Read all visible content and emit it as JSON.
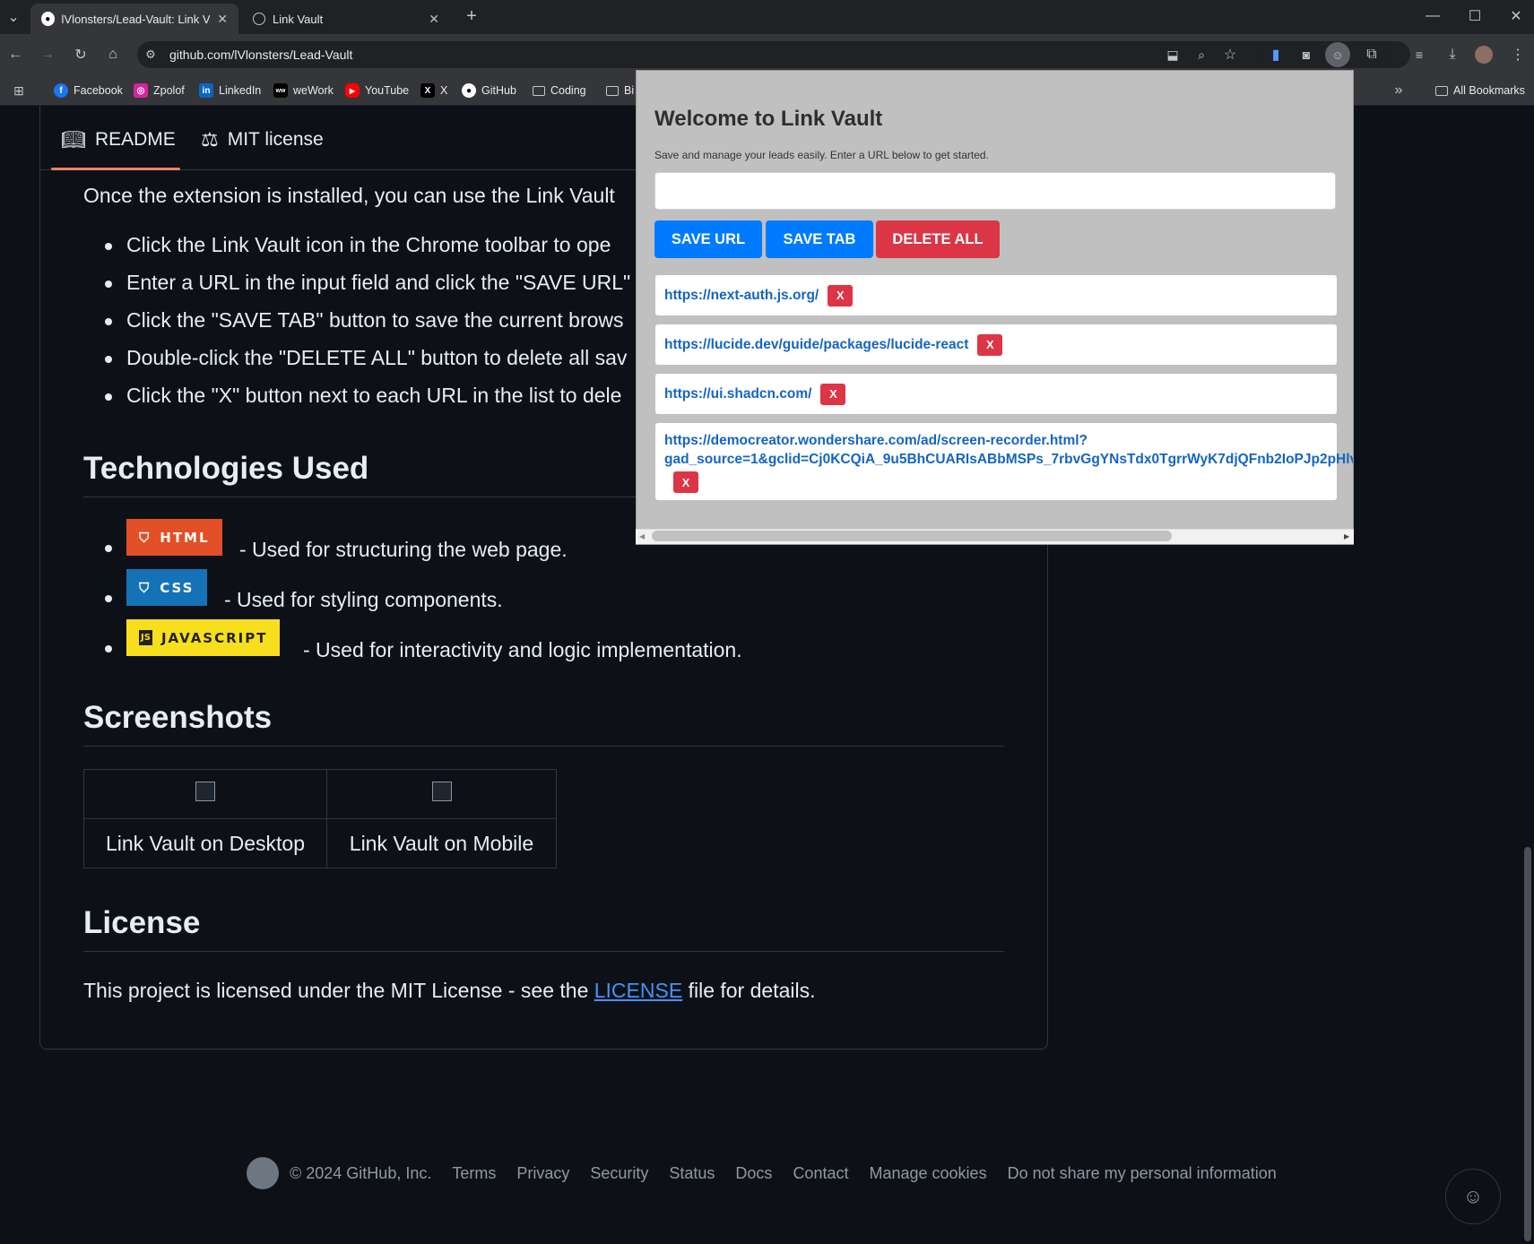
{
  "browser": {
    "tabs": [
      {
        "title": "lVlonsters/Lead-Vault: Link Vaul"
      },
      {
        "title": "Link Vault"
      }
    ],
    "url": "github.com/lVlonsters/Lead-Vault",
    "bookmarks": [
      "Facebook",
      "Zpolof",
      "LinkedIn",
      "weWork",
      "YouTube",
      "X",
      "GitHub",
      "Coding",
      "Bi"
    ],
    "all_bookmarks": "All Bookmarks"
  },
  "readme": {
    "tabs": [
      "README",
      "MIT license"
    ],
    "intro": "Once the extension is installed, you can use the Link Vault",
    "usage": [
      "Click the Link Vault icon in the Chrome toolbar to ope",
      "Enter a URL in the input field and click the \"SAVE URL\"",
      "Click the \"SAVE TAB\" button to save the current brows",
      "Double-click the \"DELETE ALL\" button to delete all sav",
      "Click the \"X\" button next to each URL in the list to dele"
    ],
    "tech_heading": "Technologies Used",
    "tech": [
      {
        "badge": "HTML",
        "text": "- Used for structuring the web page.",
        "color": "#e34f26"
      },
      {
        "badge": "CSS",
        "text": "- Used for styling components.",
        "color": "#1572b6"
      },
      {
        "badge": "JAVASCRIPT",
        "text": "- Used for interactivity and logic implementation.",
        "color": "#f7df1e"
      }
    ],
    "screenshots_heading": "Screenshots",
    "screenshots": [
      "Link Vault on Desktop",
      "Link Vault on Mobile"
    ],
    "license_heading": "License",
    "license_pre": "This project is licensed under the MIT License - see the",
    "license_link": "LICENSE",
    "license_post": "file for details."
  },
  "footer": {
    "copyright": "© 2024 GitHub, Inc.",
    "links": [
      "Terms",
      "Privacy",
      "Security",
      "Status",
      "Docs",
      "Contact",
      "Manage cookies",
      "Do not share my personal information"
    ]
  },
  "popup": {
    "title": "Welcome to Link Vault",
    "subtitle": "Save and manage your leads easily. Enter a URL below to get started.",
    "input_value": "",
    "buttons": {
      "save_url": "SAVE URL",
      "save_tab": "SAVE TAB",
      "delete_all": "DELETE ALL"
    },
    "x_label": "X",
    "urls": [
      "https://next-auth.js.org/",
      "https://lucide.dev/guide/packages/lucide-react",
      "https://ui.shadcn.com/",
      "https://democreator.wondershare.com/ad/screen-recorder.html?",
      "gad_source=1&gclid=Cj0KCQiA_9u5BhCUARIsABbMSPs_7rbvGgYNsTdx0TgrrWyK7djQFnb2IoPJp2pHlv"
    ],
    "colors": {
      "save": "#007bff",
      "delete": "#dc3545",
      "bg": "#c0c0c0",
      "link": "#1565c0"
    }
  }
}
